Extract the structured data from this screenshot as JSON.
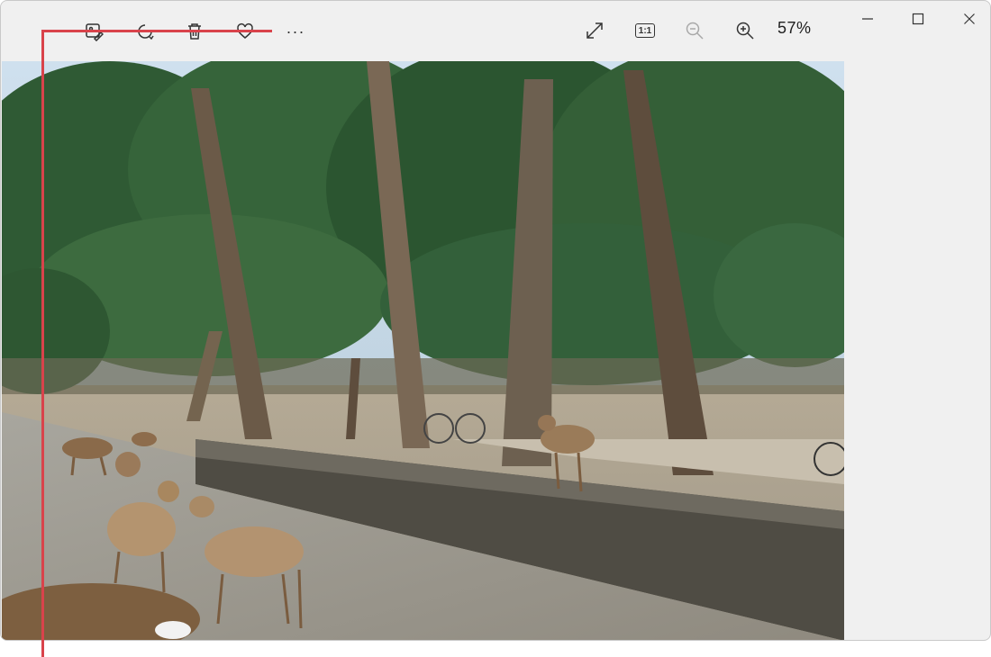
{
  "toolbar": {
    "zoom_level": "57%",
    "icons": [
      "edit-image-icon",
      "rotate-icon",
      "delete-icon",
      "favorite-icon",
      "more-options-icon",
      "fit-to-window-icon",
      "actual-size-icon",
      "zoom-out-icon",
      "zoom-in-icon"
    ],
    "actual_size_label": "1:1",
    "more_label": "···"
  },
  "window_controls": [
    "minimize-icon",
    "maximize-icon",
    "close-icon"
  ],
  "colors": {
    "callout": "#d9434b",
    "window_bg": "#f0f0f0"
  }
}
